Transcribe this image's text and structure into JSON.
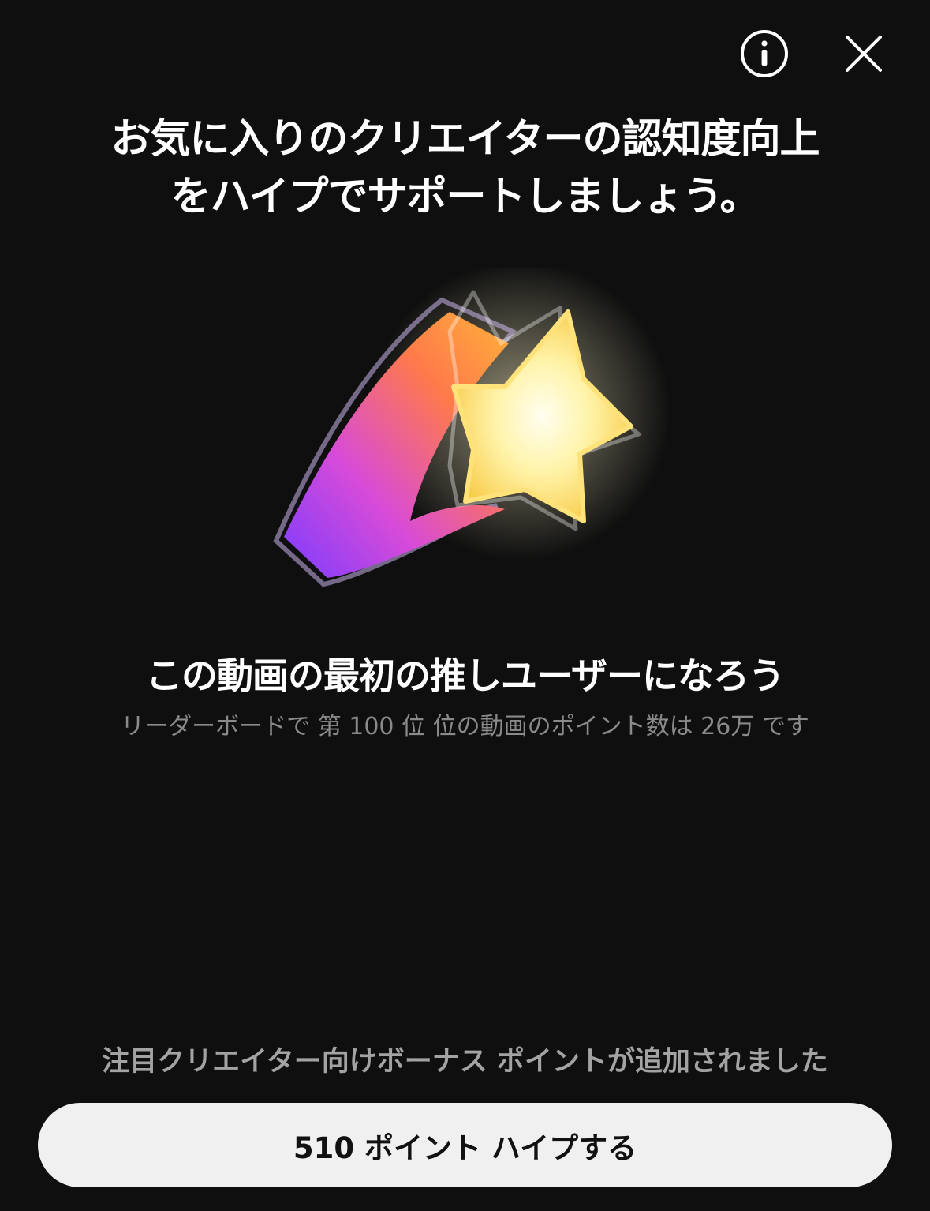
{
  "header": {
    "info_icon": "info-icon",
    "close_icon": "close-icon"
  },
  "title": {
    "line1": "お気に入りのクリエイターの認知度向上",
    "line2": "をハイプでサポートしましょう。"
  },
  "hero": {
    "icon": "shooting-star-icon"
  },
  "subtitle": "この動画の最初の推しユーザーになろう",
  "info_line": "リーダーボードで 第 100 位 位の動画のポイント数は 26万 です",
  "bonus_text": "注目クリエイター向けボーナス ポイントが追加されました",
  "hype_button": {
    "label": "510 ポイント ハイプする"
  },
  "colors": {
    "background": "#0f0f0f",
    "button_bg": "#f0f0f0",
    "secondary_text": "#8a8a8a"
  }
}
